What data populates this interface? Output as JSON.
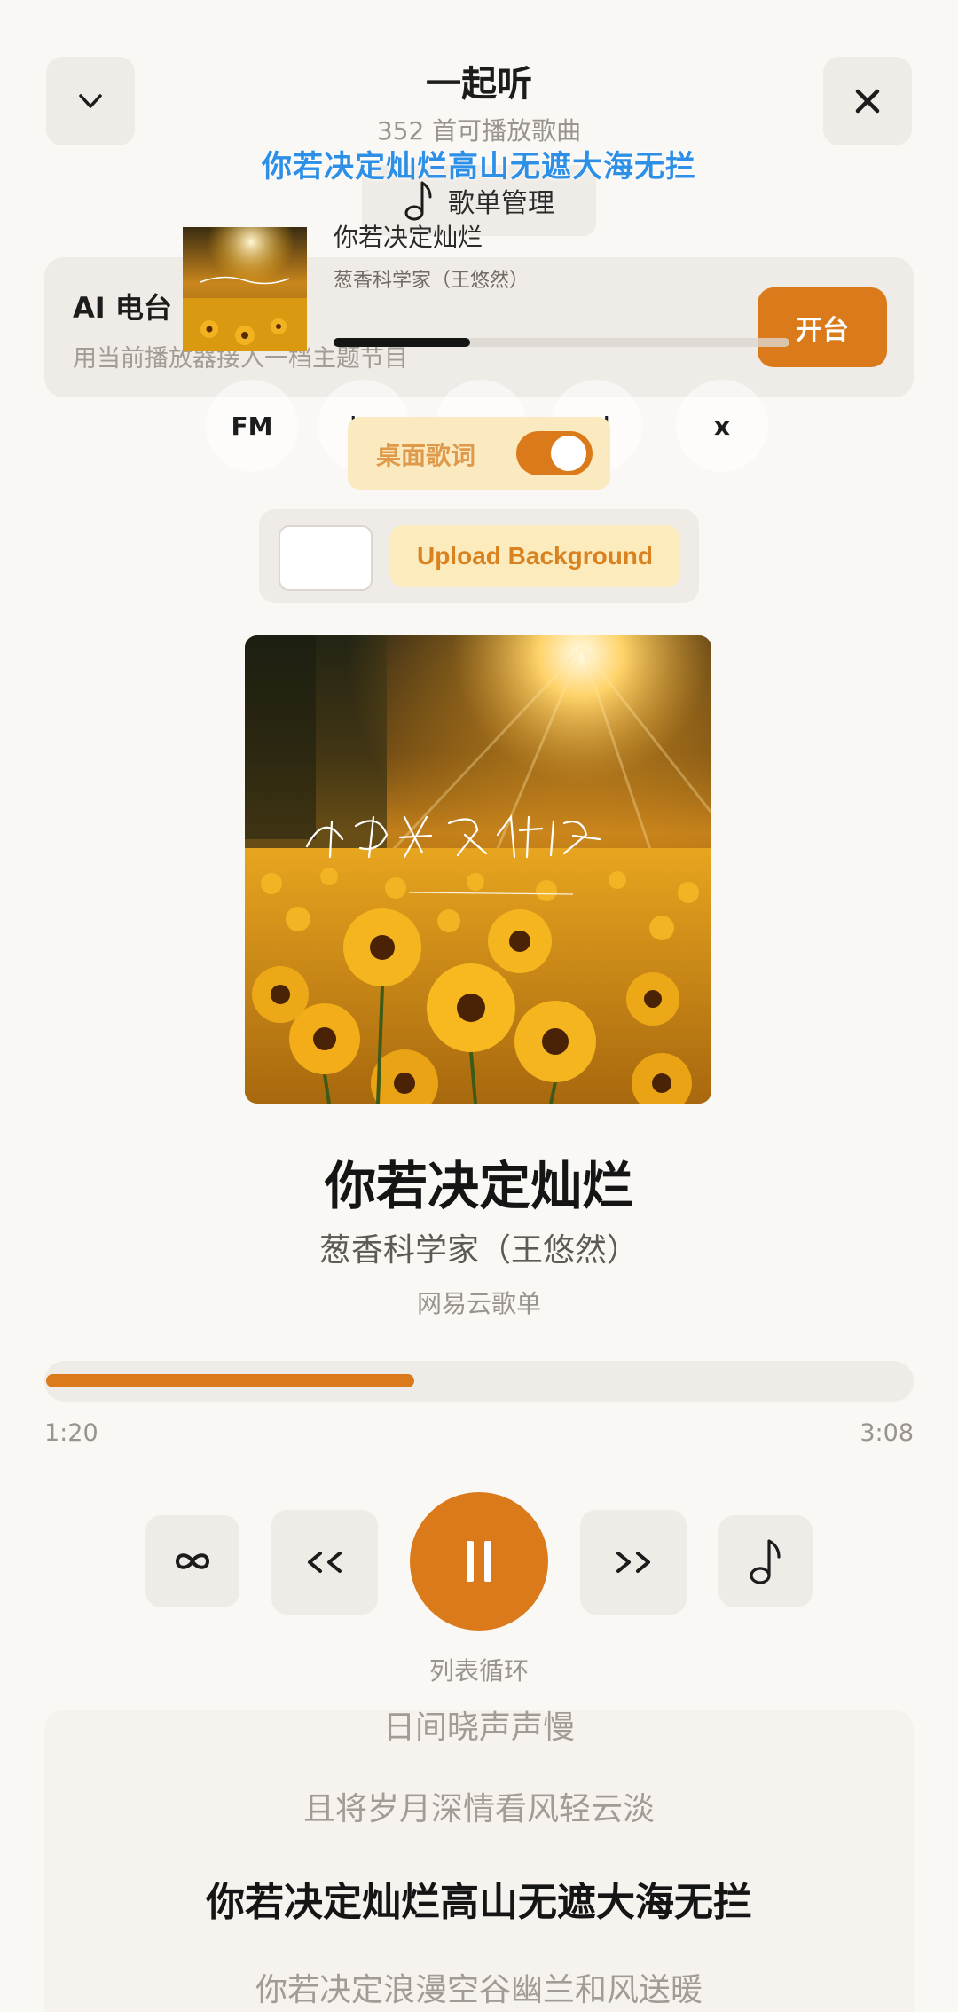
{
  "header": {
    "collapse_icon": "chevron-down-icon",
    "close_icon": "close-icon",
    "title": "一起听",
    "subtitle": "352 首可播放歌曲",
    "overlay_lyric": "你若决定灿烂高山无遮大海无拦",
    "playlist_button": {
      "icon": "music-note-icon",
      "label": "歌单管理"
    }
  },
  "ai_radio": {
    "title": "AI 电台",
    "description": "用当前播放器接入一档主题节目",
    "button": "开台"
  },
  "mini_player": {
    "title": "你若决定灿烂",
    "artist": "葱香科学家（王悠然）",
    "progress": 0.3,
    "controls": {
      "fm": "FM",
      "prev": "|<",
      "pause": "II",
      "next": ">|",
      "close": "x"
    }
  },
  "desktop_lyrics": {
    "label": "桌面歌词",
    "enabled": true
  },
  "background": {
    "upload_label": "Upload Background"
  },
  "now_playing": {
    "title": "你若决定灿烂",
    "artist": "葱香科学家（王悠然）",
    "source": "网易云歌单",
    "elapsed": "1:20",
    "duration": "3:08",
    "progress": 0.425
  },
  "controls": {
    "mode_icon": "infinity-icon",
    "prev_icon": "rewind-icon",
    "play_icon": "pause-icon",
    "next_icon": "fast-forward-icon",
    "lyrics_icon": "music-note-icon",
    "mode_label": "列表循环"
  },
  "lyrics": {
    "lines": [
      "日间晓声声慢",
      "且将岁月深情看风轻云淡",
      "你若决定灿烂高山无遮大海无拦",
      "你若决定浪漫空谷幽兰和风送暖"
    ],
    "active_index": 2
  },
  "colors": {
    "accent": "#db7a1a",
    "background": "#faf8f5",
    "card": "#efebe6",
    "overlay_lyric": "#2d8fe6"
  }
}
